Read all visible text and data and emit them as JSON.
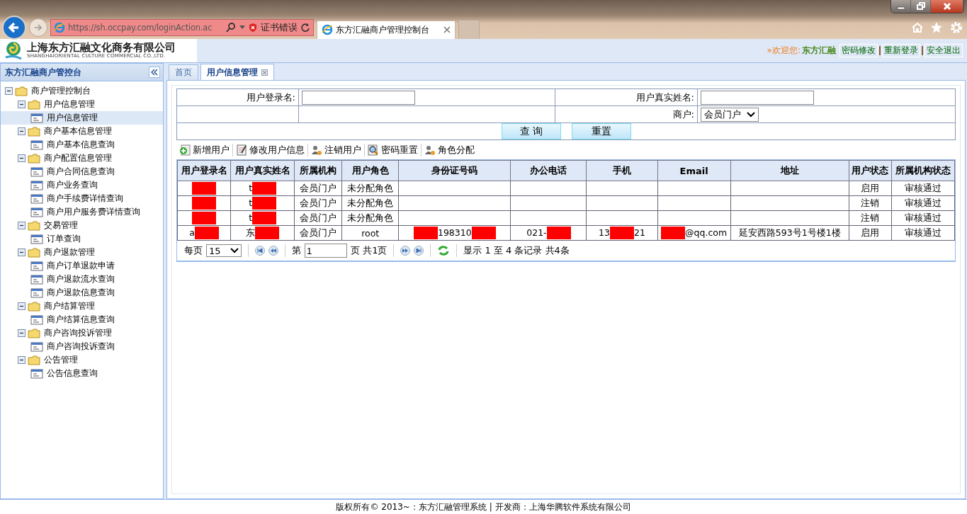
{
  "browser": {
    "address": "https://sh.occpay.com/loginAction.ac",
    "cert_error": "证书错误",
    "tab_title": "东方汇融商户管理控制台"
  },
  "header": {
    "company": "上海东方汇融文化商务有限公司",
    "company_en": "SHANGHAIORIENTAL CULTURE COMMERCIAL CO.,LTD.",
    "welcome": "»欢迎您:",
    "user": "东方汇融",
    "links": [
      "密码修改",
      "重新登录",
      "安全退出"
    ]
  },
  "sidebar": {
    "title": "东方汇融商户管控台",
    "tree": [
      {
        "label": "商户管理控制台",
        "kind": "folder",
        "expanded": true,
        "children": [
          {
            "label": "用户信息管理",
            "kind": "folder",
            "expanded": true,
            "children": [
              {
                "label": "用户信息管理",
                "kind": "page",
                "selected": true
              }
            ]
          },
          {
            "label": "商户基本信息管理",
            "kind": "folder",
            "expanded": true,
            "children": [
              {
                "label": "商户基本信息查询",
                "kind": "page",
                "selected": false
              }
            ]
          },
          {
            "label": "商户配置信息管理",
            "kind": "folder",
            "expanded": true,
            "children": [
              {
                "label": "商户合同信息查询",
                "kind": "page",
                "selected": false
              },
              {
                "label": "商户业务查询",
                "kind": "page",
                "selected": false
              },
              {
                "label": "商户手续费详情查询",
                "kind": "page",
                "selected": false
              },
              {
                "label": "商户用户服务费详情查询",
                "kind": "page",
                "selected": false
              }
            ]
          },
          {
            "label": "交易管理",
            "kind": "folder",
            "expanded": true,
            "children": [
              {
                "label": "订单查询",
                "kind": "page",
                "selected": false
              }
            ]
          },
          {
            "label": "商户退款管理",
            "kind": "folder",
            "expanded": true,
            "children": [
              {
                "label": "商户订单退款申请",
                "kind": "page",
                "selected": false
              },
              {
                "label": "商户退款流水查询",
                "kind": "page",
                "selected": false
              },
              {
                "label": "商户退款信息查询",
                "kind": "page",
                "selected": false
              }
            ]
          },
          {
            "label": "商户结算管理",
            "kind": "folder",
            "expanded": true,
            "children": [
              {
                "label": "商户结算信息查询",
                "kind": "page",
                "selected": false
              }
            ]
          },
          {
            "label": "商户咨询投诉管理",
            "kind": "folder",
            "expanded": true,
            "children": [
              {
                "label": "商户咨询投诉查询",
                "kind": "page",
                "selected": false
              }
            ]
          },
          {
            "label": "公告管理",
            "kind": "folder",
            "expanded": true,
            "children": [
              {
                "label": "公告信息查询",
                "kind": "page",
                "selected": false
              }
            ]
          }
        ]
      }
    ]
  },
  "tabs": [
    {
      "label": "首页",
      "selected": false,
      "closable": false
    },
    {
      "label": "用户信息管理",
      "selected": true,
      "closable": true
    }
  ],
  "form": {
    "login_label": "用户登录名:",
    "realname_label": "用户真实姓名:",
    "merchant_label": "商户:",
    "merchant_value": "会员门户",
    "buttons": [
      "查 询",
      "重置"
    ]
  },
  "toolbar": [
    {
      "label": "新增用户",
      "kind": "add"
    },
    {
      "label": "修改用户信息",
      "kind": "edit"
    },
    {
      "label": "注销用户",
      "kind": "user"
    },
    {
      "label": "密码重置",
      "kind": "find"
    },
    {
      "label": "角色分配",
      "kind": "user"
    }
  ],
  "table": {
    "columns": [
      "用户登录名",
      "用户真实姓名",
      "所属机构",
      "用户角色",
      "身份证号码",
      "办公电话",
      "手机",
      "Email",
      "地址",
      "用户状态",
      "所属机构状态"
    ],
    "rows": [
      [
        {
          "parts": [
            {
              "kind": "redaction"
            }
          ]
        },
        {
          "parts": [
            {
              "kind": "text",
              "text": "t"
            },
            {
              "kind": "redaction"
            }
          ]
        },
        {
          "parts": [
            {
              "kind": "text",
              "text": "会员门户"
            }
          ]
        },
        {
          "parts": [
            {
              "kind": "text",
              "text": "未分配角色"
            }
          ]
        },
        {},
        {},
        {},
        {},
        {},
        {
          "parts": [
            {
              "kind": "text",
              "text": "启用"
            }
          ]
        },
        {
          "parts": [
            {
              "kind": "text",
              "text": "审核通过"
            }
          ]
        }
      ],
      [
        {
          "parts": [
            {
              "kind": "redaction"
            }
          ]
        },
        {
          "parts": [
            {
              "kind": "text",
              "text": "t"
            },
            {
              "kind": "redaction"
            }
          ]
        },
        {
          "parts": [
            {
              "kind": "text",
              "text": "会员门户"
            }
          ]
        },
        {
          "parts": [
            {
              "kind": "text",
              "text": "未分配角色"
            }
          ]
        },
        {},
        {},
        {},
        {},
        {},
        {
          "parts": [
            {
              "kind": "text",
              "text": "注销"
            }
          ]
        },
        {
          "parts": [
            {
              "kind": "text",
              "text": "审核通过"
            }
          ]
        }
      ],
      [
        {
          "parts": [
            {
              "kind": "redaction"
            }
          ]
        },
        {
          "parts": [
            {
              "kind": "text",
              "text": "t"
            },
            {
              "kind": "redaction"
            }
          ]
        },
        {
          "parts": [
            {
              "kind": "text",
              "text": "会员门户"
            }
          ]
        },
        {
          "parts": [
            {
              "kind": "text",
              "text": "未分配角色"
            }
          ]
        },
        {},
        {},
        {},
        {},
        {},
        {
          "parts": [
            {
              "kind": "text",
              "text": "注销"
            }
          ]
        },
        {
          "parts": [
            {
              "kind": "text",
              "text": "审核通过"
            }
          ]
        }
      ],
      [
        {
          "parts": [
            {
              "kind": "text",
              "text": "a"
            },
            {
              "kind": "redaction"
            }
          ]
        },
        {
          "parts": [
            {
              "kind": "text",
              "text": "东"
            },
            {
              "kind": "redaction"
            }
          ]
        },
        {
          "parts": [
            {
              "kind": "text",
              "text": "会员门户"
            }
          ]
        },
        {
          "parts": [
            {
              "kind": "text",
              "text": "root"
            }
          ]
        },
        {
          "parts": [
            {
              "kind": "redaction"
            },
            {
              "kind": "text",
              "text": "198310"
            },
            {
              "kind": "redaction"
            }
          ]
        },
        {
          "parts": [
            {
              "kind": "text",
              "text": "021-"
            },
            {
              "kind": "redaction"
            }
          ]
        },
        {
          "parts": [
            {
              "kind": "text",
              "text": "13"
            },
            {
              "kind": "redaction"
            },
            {
              "kind": "text",
              "text": "21"
            }
          ]
        },
        {
          "parts": [
            {
              "kind": "redaction"
            },
            {
              "kind": "text",
              "text": "@qq.com"
            }
          ]
        },
        {
          "parts": [
            {
              "kind": "text",
              "text": "延安西路593号1号楼1楼"
            }
          ]
        },
        {
          "parts": [
            {
              "kind": "text",
              "text": "启用"
            }
          ]
        },
        {
          "parts": [
            {
              "kind": "text",
              "text": "审核通过"
            }
          ]
        }
      ]
    ]
  },
  "pager": {
    "per_page_label": "每页",
    "per_page": "15",
    "page_label": "第",
    "page": "1",
    "page_total": "页 共1页",
    "summary": "显示 1 至 4 条记录 共4条"
  },
  "footer": "版权所有© 2013~：东方汇融管理系统 | 开发商：上海华腾软件系统有限公司"
}
